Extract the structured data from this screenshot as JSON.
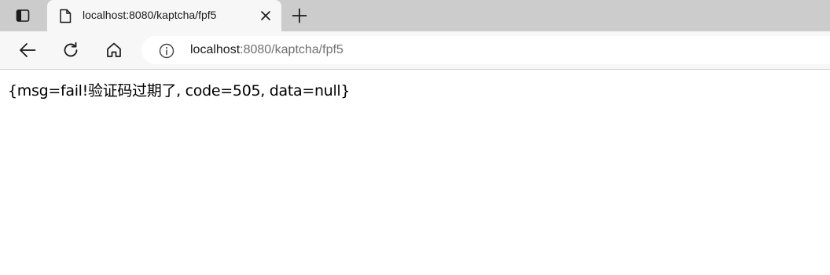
{
  "tab": {
    "title": "localhost:8080/kaptcha/fpf5"
  },
  "address_bar": {
    "host": "localhost",
    "path": ":8080/kaptcha/fpf5"
  },
  "icons": {
    "tab_actions": "tab-actions-icon",
    "favicon": "page-icon",
    "close": "close-icon",
    "new_tab": "plus-icon",
    "back": "back-arrow-icon",
    "refresh": "refresh-icon",
    "home": "home-icon",
    "site_info": "info-icon"
  },
  "page": {
    "text": "{msg=fail!验证码过期了, code=505, data=null}"
  }
}
